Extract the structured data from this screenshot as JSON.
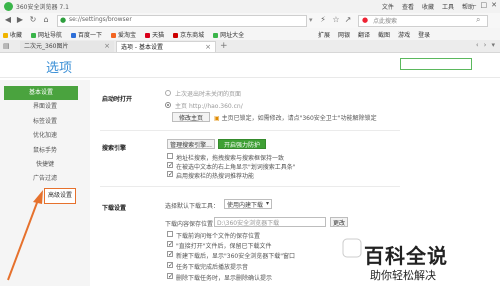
{
  "window": {
    "title": "360安全浏览器 7.1",
    "menu": [
      "文件",
      "查看",
      "收藏",
      "工具",
      "帮助"
    ]
  },
  "address": {
    "url": "se://settings/browser",
    "search_placeholder": "点此搜索"
  },
  "bookmarks": {
    "items": [
      "收藏",
      "网址导航",
      "百度一下",
      "爱淘宝",
      "天猫",
      "京东商城",
      "网址大全"
    ],
    "right": [
      "扩展",
      "网银",
      "翻译",
      "截图",
      "游戏",
      "登录"
    ]
  },
  "tabs": [
    {
      "label": "二次元_360图片"
    },
    {
      "label": "选项 - 基本设置"
    }
  ],
  "settings": {
    "title": "选项"
  },
  "sidebar": {
    "items": [
      "基本设置",
      "界面设置",
      "标签设置",
      "优化加速",
      "鼠标手势",
      "快捷键",
      "广告过滤",
      "高级设置"
    ]
  },
  "startup": {
    "label": "启动时打开",
    "option1": "上次退出时未关闭的页面",
    "option2_prefix": "主页",
    "homepage_url": "http://hao.360.cn/",
    "change_button": "修改主页",
    "notice": "主页已锁定，如需修改，请点\"360安全卫士\"功能解除锁定"
  },
  "search_engine": {
    "label": "搜索引擎",
    "manage_button": "管理搜索引擎...",
    "protect_button": "开启强力防护",
    "options": [
      {
        "text": "地址栏搜索，拖拽搜索与搜索框保持一致",
        "checked": false
      },
      {
        "text": "在被选中文本的右上角显示\"划词搜索工具条\"",
        "checked": true
      },
      {
        "text": "启用搜索栏的热搜词推荐功能",
        "checked": true
      }
    ]
  },
  "download": {
    "label": "下载设置",
    "tool_label": "选择默认下载工具：",
    "tool_value": "使用内建下载",
    "dir_label": "下载内容保存位置：",
    "dir_value": "D:\\360安全浏览器下载",
    "change_button": "更改",
    "options": [
      {
        "text": "下载前询问每个文件的保存位置",
        "checked": false
      },
      {
        "text": "\"直接打开\"文件后，保留已下载文件",
        "checked": true
      },
      {
        "text": "新建下载后，显示\"360安全浏览器下载\"窗口",
        "checked": true
      },
      {
        "text": "任务下载完成后播放提示音",
        "checked": true
      },
      {
        "text": "删除下载任务时，显示删除确认提示",
        "checked": true
      }
    ]
  },
  "watermark": {
    "title": "百科全说",
    "subtitle": "助你轻松解决"
  },
  "colors": {
    "accent_green": "#4aa33e",
    "link_blue": "#3a8fd6",
    "highlight_orange": "#e6712d"
  }
}
